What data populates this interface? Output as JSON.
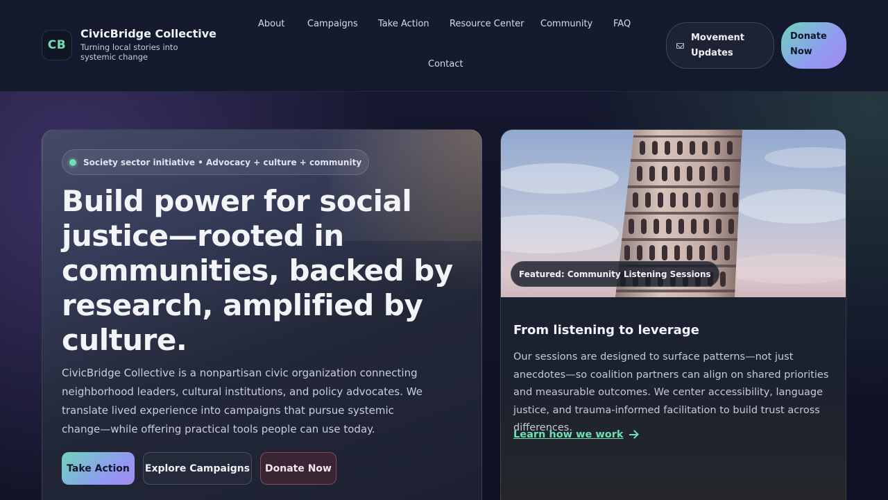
{
  "brand": {
    "logo": "CB",
    "name": "CivicBridge Collective",
    "tagline": "Turning local stories into systemic change"
  },
  "nav": {
    "items": [
      "About",
      "Campaigns",
      "Take Action",
      "Resource Center",
      "Community",
      "FAQ",
      "Contact"
    ]
  },
  "header_actions": {
    "updates_label": "Movement Updates",
    "updates_icon": "mail-icon",
    "donate_label": "Donate Now"
  },
  "hero": {
    "pill": "Society sector initiative • Advocacy + culture + community",
    "headline": "Build power for social justice—rooted in communities, backed by research, amplified by culture.",
    "description": "CivicBridge Collective is a nonpartisan civic organization connecting neighborhood leaders, cultural institutions, and policy advocates. We translate lived experience into campaigns that pursue systemic change—while offering practical tools people can use today.",
    "buttons": {
      "take_action": "Take Action",
      "explore": "Explore Campaigns",
      "donate": "Donate Now"
    }
  },
  "feature": {
    "image_label": "Featured: Community Listening Sessions",
    "title": "From listening to leverage",
    "description": "Our sessions are designed to surface patterns—not just anecdotes—so coalition partners can align on shared priorities and measurable outcomes. We center accessibility, language justice, and trauma-informed facilitation to build trust across differences.",
    "link": "Learn how we work"
  },
  "colors": {
    "accent_green": "#6fe0b6",
    "accent_violet": "#a48af0",
    "background": "#0f1224"
  }
}
